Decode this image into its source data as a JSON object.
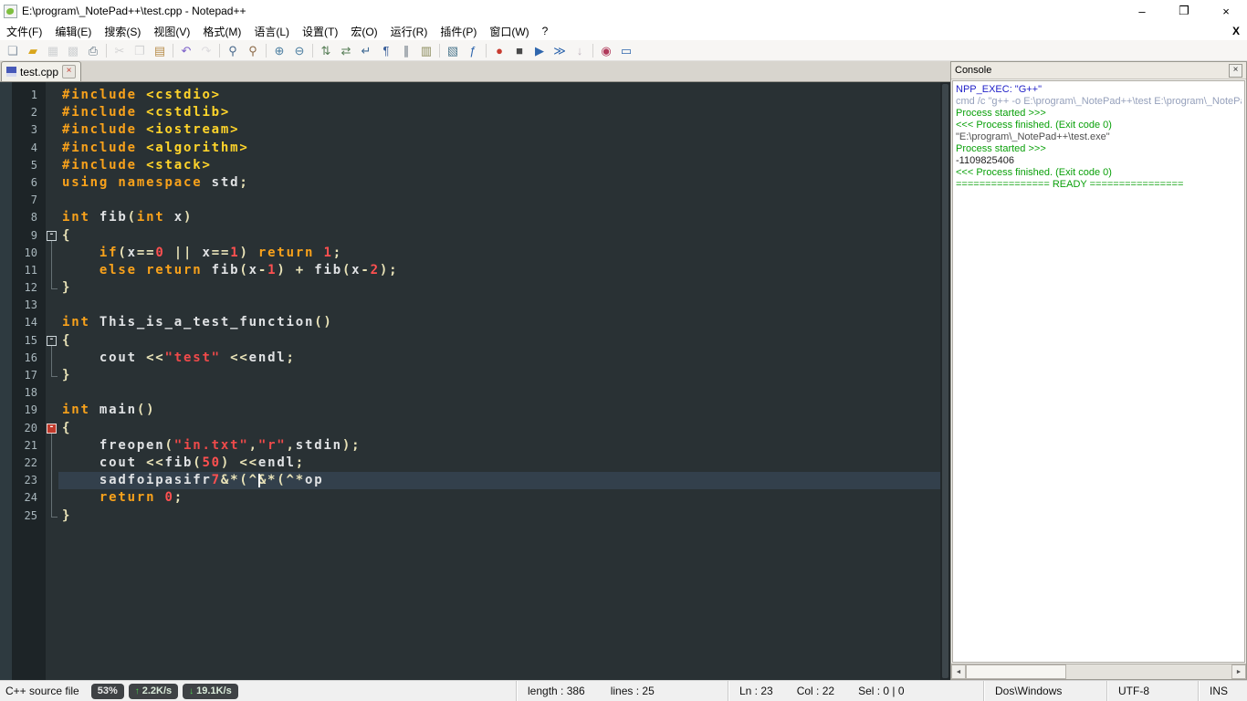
{
  "window": {
    "title": "E:\\program\\_NotePad++\\test.cpp - Notepad++",
    "controls": {
      "minimize": "–",
      "restore": "❐",
      "close": "×"
    },
    "document_close": "X"
  },
  "menu": {
    "items": [
      {
        "key": "file",
        "label": "文件(F)"
      },
      {
        "key": "edit",
        "label": "编辑(E)"
      },
      {
        "key": "search",
        "label": "搜索(S)"
      },
      {
        "key": "view",
        "label": "视图(V)"
      },
      {
        "key": "format",
        "label": "格式(M)"
      },
      {
        "key": "language",
        "label": "语言(L)"
      },
      {
        "key": "settings",
        "label": "设置(T)"
      },
      {
        "key": "macro",
        "label": "宏(O)"
      },
      {
        "key": "run",
        "label": "运行(R)"
      },
      {
        "key": "plugins",
        "label": "插件(P)"
      },
      {
        "key": "window",
        "label": "窗口(W)"
      },
      {
        "key": "help",
        "label": "?"
      }
    ]
  },
  "toolbar": {
    "icons": [
      {
        "name": "new-file",
        "glyph": "❏",
        "color": "#8a97a5"
      },
      {
        "name": "open-file",
        "glyph": "▰",
        "color": "#d9a61c"
      },
      {
        "name": "save",
        "glyph": "▦",
        "color": "#8fa0b0",
        "disabled": true
      },
      {
        "name": "save-all",
        "glyph": "▩",
        "color": "#8fa0b0",
        "disabled": true
      },
      {
        "name": "print",
        "glyph": "⎙",
        "color": "#5f7180"
      },
      {
        "sep": true
      },
      {
        "name": "cut",
        "glyph": "✂",
        "color": "#9aa0a6",
        "disabled": true
      },
      {
        "name": "copy",
        "glyph": "❐",
        "color": "#9aa0a6",
        "disabled": true
      },
      {
        "name": "paste",
        "glyph": "▤",
        "color": "#b98f4e"
      },
      {
        "sep": true
      },
      {
        "name": "undo",
        "glyph": "↶",
        "color": "#7b5fc9"
      },
      {
        "name": "redo",
        "glyph": "↷",
        "color": "#b7b1cf",
        "disabled": true
      },
      {
        "sep": true
      },
      {
        "name": "find",
        "glyph": "⚲",
        "color": "#48688c"
      },
      {
        "name": "replace",
        "glyph": "⚲",
        "color": "#8c6a48"
      },
      {
        "sep": true
      },
      {
        "name": "zoom-in",
        "glyph": "⊕",
        "color": "#4a7da0"
      },
      {
        "name": "zoom-out",
        "glyph": "⊖",
        "color": "#4a7da0"
      },
      {
        "sep": true
      },
      {
        "name": "sync-vertical-scroll",
        "glyph": "⇅",
        "color": "#567d56"
      },
      {
        "name": "sync-horizontal-scroll",
        "glyph": "⇄",
        "color": "#567d56"
      },
      {
        "name": "word-wrap",
        "glyph": "↵",
        "color": "#3f6a94"
      },
      {
        "name": "show-all-characters",
        "glyph": "¶",
        "color": "#3a5f9a"
      },
      {
        "name": "indent-guide",
        "glyph": "∥",
        "color": "#5d6b78"
      },
      {
        "name": "user-defined-dialog",
        "glyph": "▥",
        "color": "#8a8a5a"
      },
      {
        "sep": true
      },
      {
        "name": "document-map",
        "glyph": "▧",
        "color": "#4f7a8f"
      },
      {
        "name": "function-list",
        "glyph": "ƒ",
        "color": "#2f66ad"
      },
      {
        "sep": true
      },
      {
        "name": "record-macro",
        "glyph": "●",
        "color": "#c83c30"
      },
      {
        "name": "stop-macro",
        "glyph": "■",
        "color": "#4a4a4a"
      },
      {
        "name": "play-macro",
        "glyph": "▶",
        "color": "#2f66ad"
      },
      {
        "name": "run-macro-multiple",
        "glyph": "≫",
        "color": "#2f66ad"
      },
      {
        "name": "save-macro",
        "glyph": "↓",
        "color": "#8a4a8a",
        "disabled": true
      },
      {
        "sep": true
      },
      {
        "name": "nppexec-run",
        "glyph": "◉",
        "color": "#b03a5a"
      },
      {
        "name": "nppexec-console",
        "glyph": "▭",
        "color": "#2f66ad"
      }
    ]
  },
  "tabbar": {
    "active_tab": "test.cpp",
    "close_glyph": "×"
  },
  "editor": {
    "caret": {
      "line": 23,
      "col": 22
    },
    "lines": [
      {
        "n": 1,
        "fold": "",
        "t": [
          [
            "kw",
            "#include"
          ],
          [
            "d",
            " "
          ],
          [
            "hdr",
            "<cstdio>"
          ]
        ]
      },
      {
        "n": 2,
        "fold": "",
        "t": [
          [
            "kw",
            "#include"
          ],
          [
            "d",
            " "
          ],
          [
            "hdr",
            "<cstdlib>"
          ]
        ]
      },
      {
        "n": 3,
        "fold": "",
        "t": [
          [
            "kw",
            "#include"
          ],
          [
            "d",
            " "
          ],
          [
            "hdr",
            "<iostream>"
          ]
        ]
      },
      {
        "n": 4,
        "fold": "",
        "t": [
          [
            "kw",
            "#include"
          ],
          [
            "d",
            " "
          ],
          [
            "hdr",
            "<algorithm>"
          ]
        ]
      },
      {
        "n": 5,
        "fold": "",
        "t": [
          [
            "kw",
            "#include"
          ],
          [
            "d",
            " "
          ],
          [
            "hdr",
            "<stack>"
          ]
        ]
      },
      {
        "n": 6,
        "fold": "",
        "t": [
          [
            "kw",
            "using"
          ],
          [
            "d",
            " "
          ],
          [
            "kw",
            "namespace"
          ],
          [
            "d",
            " std"
          ],
          [
            "op",
            ";"
          ]
        ]
      },
      {
        "n": 7,
        "fold": "",
        "t": []
      },
      {
        "n": 8,
        "fold": "",
        "t": [
          [
            "kw",
            "int"
          ],
          [
            "d",
            " fib"
          ],
          [
            "op",
            "("
          ],
          [
            "kw",
            "int"
          ],
          [
            "d",
            " x"
          ],
          [
            "op",
            ")"
          ]
        ]
      },
      {
        "n": 9,
        "fold": "open",
        "t": [
          [
            "op",
            "{"
          ]
        ]
      },
      {
        "n": 10,
        "fold": "mid",
        "t": [
          [
            "d",
            "    "
          ],
          [
            "kw",
            "if"
          ],
          [
            "op",
            "("
          ],
          [
            "d",
            "x"
          ],
          [
            "op",
            "=="
          ],
          [
            "num",
            "0"
          ],
          [
            "d",
            " "
          ],
          [
            "op",
            "||"
          ],
          [
            "d",
            " x"
          ],
          [
            "op",
            "=="
          ],
          [
            "num",
            "1"
          ],
          [
            "op",
            ")"
          ],
          [
            "d",
            " "
          ],
          [
            "kw",
            "return"
          ],
          [
            "d",
            " "
          ],
          [
            "num",
            "1"
          ],
          [
            "op",
            ";"
          ]
        ]
      },
      {
        "n": 11,
        "fold": "mid",
        "t": [
          [
            "d",
            "    "
          ],
          [
            "kw",
            "else"
          ],
          [
            "d",
            " "
          ],
          [
            "kw",
            "return"
          ],
          [
            "d",
            " fib"
          ],
          [
            "op",
            "("
          ],
          [
            "d",
            "x"
          ],
          [
            "op",
            "-"
          ],
          [
            "num",
            "1"
          ],
          [
            "op",
            ")"
          ],
          [
            "d",
            " "
          ],
          [
            "op",
            "+"
          ],
          [
            "d",
            " fib"
          ],
          [
            "op",
            "("
          ],
          [
            "d",
            "x"
          ],
          [
            "op",
            "-"
          ],
          [
            "num",
            "2"
          ],
          [
            "op",
            ");"
          ]
        ]
      },
      {
        "n": 12,
        "fold": "end",
        "t": [
          [
            "op",
            "}"
          ]
        ]
      },
      {
        "n": 13,
        "fold": "",
        "t": []
      },
      {
        "n": 14,
        "fold": "",
        "t": [
          [
            "kw",
            "int"
          ],
          [
            "d",
            " This_is_a_test_function"
          ],
          [
            "op",
            "()"
          ]
        ]
      },
      {
        "n": 15,
        "fold": "open",
        "t": [
          [
            "op",
            "{"
          ]
        ]
      },
      {
        "n": 16,
        "fold": "mid",
        "t": [
          [
            "d",
            "    cout "
          ],
          [
            "op",
            "<<"
          ],
          [
            "str",
            "\"test\""
          ],
          [
            "d",
            " "
          ],
          [
            "op",
            "<<"
          ],
          [
            "d",
            "endl"
          ],
          [
            "op",
            ";"
          ]
        ]
      },
      {
        "n": 17,
        "fold": "end",
        "t": [
          [
            "op",
            "}"
          ]
        ]
      },
      {
        "n": 18,
        "fold": "",
        "t": []
      },
      {
        "n": 19,
        "fold": "",
        "t": [
          [
            "kw",
            "int"
          ],
          [
            "d",
            " main"
          ],
          [
            "op",
            "()"
          ]
        ]
      },
      {
        "n": 20,
        "fold": "open-active",
        "t": [
          [
            "op",
            "{"
          ]
        ]
      },
      {
        "n": 21,
        "fold": "mid",
        "t": [
          [
            "d",
            "    freopen"
          ],
          [
            "op",
            "("
          ],
          [
            "str",
            "\"in.txt\""
          ],
          [
            "op",
            ","
          ],
          [
            "str",
            "\"r\""
          ],
          [
            "op",
            ","
          ],
          [
            "d",
            "stdin"
          ],
          [
            "op",
            ");"
          ]
        ]
      },
      {
        "n": 22,
        "fold": "mid",
        "t": [
          [
            "d",
            "    cout "
          ],
          [
            "op",
            "<<"
          ],
          [
            "d",
            "fib"
          ],
          [
            "op",
            "("
          ],
          [
            "num",
            "50"
          ],
          [
            "op",
            ")"
          ],
          [
            "d",
            " "
          ],
          [
            "op",
            "<<"
          ],
          [
            "d",
            "endl"
          ],
          [
            "op",
            ";"
          ]
        ]
      },
      {
        "n": 23,
        "fold": "mid",
        "t": [
          [
            "d",
            "    sadfoipasifr"
          ],
          [
            "num",
            "7"
          ],
          [
            "op",
            "&*(^&*(^*"
          ],
          [
            "d",
            "op"
          ]
        ]
      },
      {
        "n": 24,
        "fold": "mid",
        "t": [
          [
            "d",
            "    "
          ],
          [
            "kw",
            "return"
          ],
          [
            "d",
            " "
          ],
          [
            "num",
            "0"
          ],
          [
            "op",
            ";"
          ]
        ]
      },
      {
        "n": 25,
        "fold": "end",
        "t": [
          [
            "op",
            "}"
          ]
        ]
      }
    ]
  },
  "console": {
    "title": "Console",
    "close_glyph": "×",
    "lines": [
      {
        "c": "blue",
        "text": "NPP_EXEC: \"G++\""
      },
      {
        "c": "dim",
        "text": "cmd /c \"g++ -o E:\\program\\_NotePad++\\test E:\\program\\_NotePa"
      },
      {
        "c": "green",
        "text": "Process started >>>"
      },
      {
        "c": "green",
        "text": "<<< Process finished. (Exit code 0)"
      },
      {
        "c": "gray",
        "text": "\"E:\\program\\_NotePad++\\test.exe\""
      },
      {
        "c": "green",
        "text": "Process started >>>"
      },
      {
        "c": "black",
        "text": "-1109825406"
      },
      {
        "c": "green",
        "text": "<<< Process finished. (Exit code 0)"
      },
      {
        "c": "green",
        "text": "================ READY ================"
      }
    ],
    "scrollbar": {
      "left_arrow": "◄",
      "right_arrow": "►"
    }
  },
  "status": {
    "doc_type": "C++ source file",
    "overlay": {
      "percent": "53%",
      "up_arrow": "↑",
      "up_speed": "2.2K/s",
      "down_arrow": "↓",
      "down_speed": "19.1K/s"
    },
    "length_label": "length : 386",
    "lines_label": "lines : 25",
    "ln_label": "Ln : 23",
    "col_label": "Col : 22",
    "sel_label": "Sel : 0 | 0",
    "eol": "Dos\\Windows",
    "encoding": "UTF-8",
    "insert_mode": "INS"
  },
  "colors": {
    "editor_bg": "#293134",
    "keyword": "#f9a21b",
    "header": "#ffd42a",
    "number": "#ff5050",
    "string": "#f04a4a",
    "operator": "#e8e2b7",
    "default_text": "#e0e2e4",
    "current_line_bg": "#33404c",
    "console_green": "#0aa00a",
    "console_blue": "#2121c8",
    "fold_active_marker": "#c0392b"
  }
}
